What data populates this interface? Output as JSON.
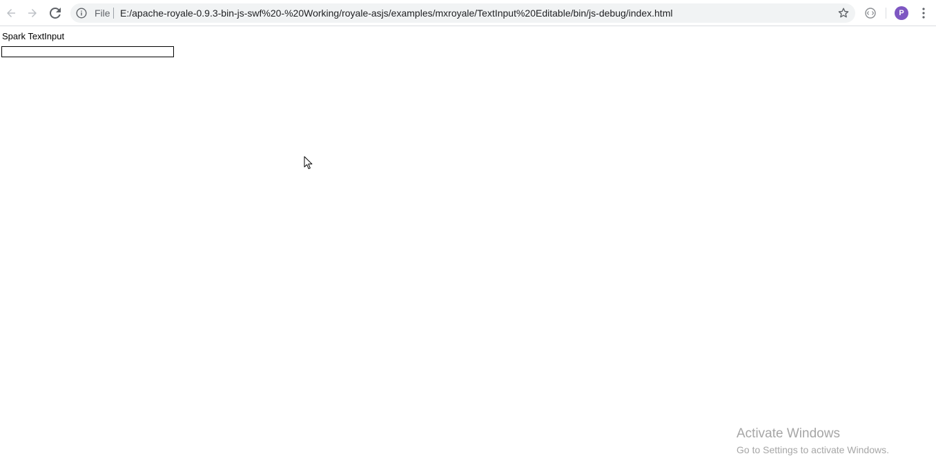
{
  "browser": {
    "scheme_label": "File",
    "url": "E:/apache-royale-0.9.3-bin-js-swf%20-%20Working/royale-asjs/examples/mxroyale/TextInput%20Editable/bin/js-debug/index.html",
    "profile_initial": "P",
    "icons": {
      "back": "arrow-left-icon",
      "forward": "arrow-right-icon",
      "reload": "reload-icon",
      "info": "info-icon",
      "bookmark": "star-icon",
      "extension": "extension-icon",
      "menu": "kebab-menu-icon"
    },
    "colors": {
      "avatar": "#7e57c2",
      "omnibox": "#f1f3f4"
    }
  },
  "page": {
    "label": "Spark TextInput",
    "input_value": ""
  },
  "watermark": {
    "title": "Activate Windows",
    "subtitle": "Go to Settings to activate Windows."
  }
}
